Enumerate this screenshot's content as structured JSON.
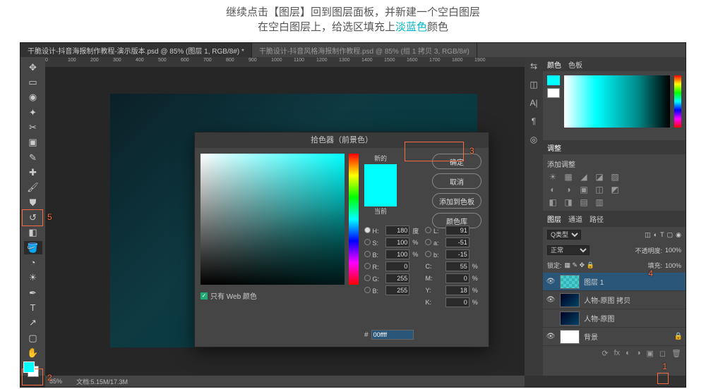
{
  "instruction": {
    "line1_pre": "继续点击【图层】回到图层面板，并新建一个空白图层",
    "line2_pre": "在空白图层上，给选区填充上",
    "line2_hl": "淡蓝色",
    "line2_post": "颜色"
  },
  "tabs": {
    "t1": "干脆设计-抖音海报制作教程-演示版本.psd @ 85% (图层 1, RGB/8#) *",
    "t2": "干脆设计-抖音风格海报制作教程.psd @ 85% (组 1 拷贝 3, RGB/8#)"
  },
  "ruler": [
    "0",
    "100",
    "200",
    "300",
    "400",
    "500",
    "600",
    "700",
    "800",
    "900",
    "1000",
    "1100",
    "1200",
    "1300",
    "1400",
    "1500",
    "1600",
    "1700",
    "1800",
    "1900"
  ],
  "marks": {
    "m1": "1",
    "m2": "2",
    "m3": "3",
    "m4": "4",
    "m5": "5"
  },
  "panels": {
    "color_tab1": "颜色",
    "color_tab2": "色板",
    "adj_tab": "调整",
    "adj_label": "添加调整",
    "layers_tab1": "图层",
    "layers_tab2": "通道",
    "layers_tab3": "路径",
    "kind": "Q类型",
    "blend": "正常",
    "opacity_l": "不透明度:",
    "opacity_v": "100%",
    "lock_l": "锁定:",
    "fill_l": "填充:",
    "fill_v": "100%",
    "layers": [
      {
        "name": "图层 1"
      },
      {
        "name": "人物-原图 拷贝"
      },
      {
        "name": "人物-原图"
      },
      {
        "name": "背景"
      }
    ]
  },
  "status": {
    "zoom": "85%",
    "doc": "文档:5.15M/17.3M"
  },
  "dialog": {
    "title": "拾色器（前景色）",
    "new": "新的",
    "cur": "当前",
    "ok": "确定",
    "cancel": "取消",
    "add": "添加到色板",
    "lib": "颜色库",
    "webonly": "只有 Web 颜色",
    "H": "H:",
    "Hv": "180",
    "Hd": "度",
    "S": "S:",
    "Sv": "100",
    "Sp": "%",
    "Bb": "B:",
    "Bbv": "100",
    "Bbp": "%",
    "R": "R:",
    "Rv": "0",
    "G": "G:",
    "Gv": "255",
    "B2": "B:",
    "B2v": "255",
    "L": "L:",
    "Lv": "91",
    "a": "a:",
    "av": "-51",
    "b": "b:",
    "bv": "-15",
    "C": "C:",
    "Cv": "55",
    "Cp": "%",
    "M": "M:",
    "Mv": "0",
    "Mp": "%",
    "Y": "Y:",
    "Yv": "18",
    "Yp": "%",
    "K": "K:",
    "Kv": "0",
    "Kp": "%",
    "hash": "#",
    "hex": "00ffff"
  }
}
